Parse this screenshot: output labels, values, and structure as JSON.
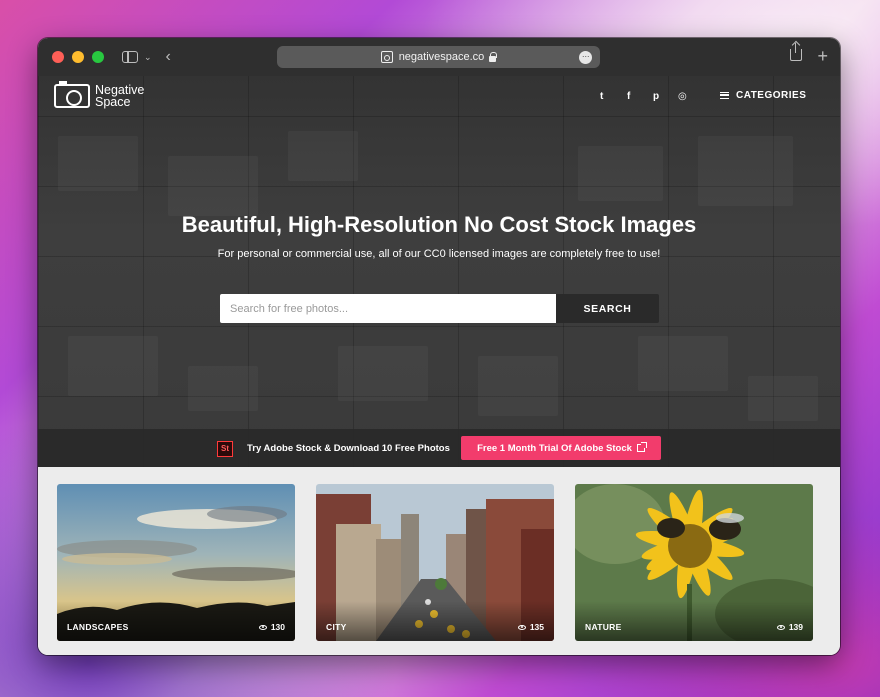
{
  "browser": {
    "url": "negativespace.co"
  },
  "site": {
    "logo_line1": "Negative",
    "logo_line2": "Space",
    "nav": {
      "social_icons": [
        "twitter-icon",
        "facebook-icon",
        "pinterest-icon",
        "instagram-icon"
      ],
      "twitter": "t",
      "facebook": "f",
      "pinterest": "p",
      "instagram": "◎",
      "categories_label": "CATEGORIES"
    },
    "hero": {
      "headline": "Beautiful, High-Resolution No Cost Stock Images",
      "subline": "For personal or commercial use, all of our CC0 licensed images are completely free to use!",
      "search_placeholder": "Search for free photos...",
      "search_button": "SEARCH"
    },
    "promo": {
      "badge": "St",
      "text": "Try Adobe Stock & Download 10 Free Photos",
      "cta": "Free 1 Month Trial Of Adobe Stock"
    },
    "categories": [
      {
        "label": "LANDSCAPES",
        "views": "130"
      },
      {
        "label": "CITY",
        "views": "135"
      },
      {
        "label": "NATURE",
        "views": "139"
      }
    ]
  },
  "colors": {
    "accent_cta": "#f23c6c",
    "hero_bg": "#3a3a3a",
    "titlebar": "#2f2f2f"
  }
}
